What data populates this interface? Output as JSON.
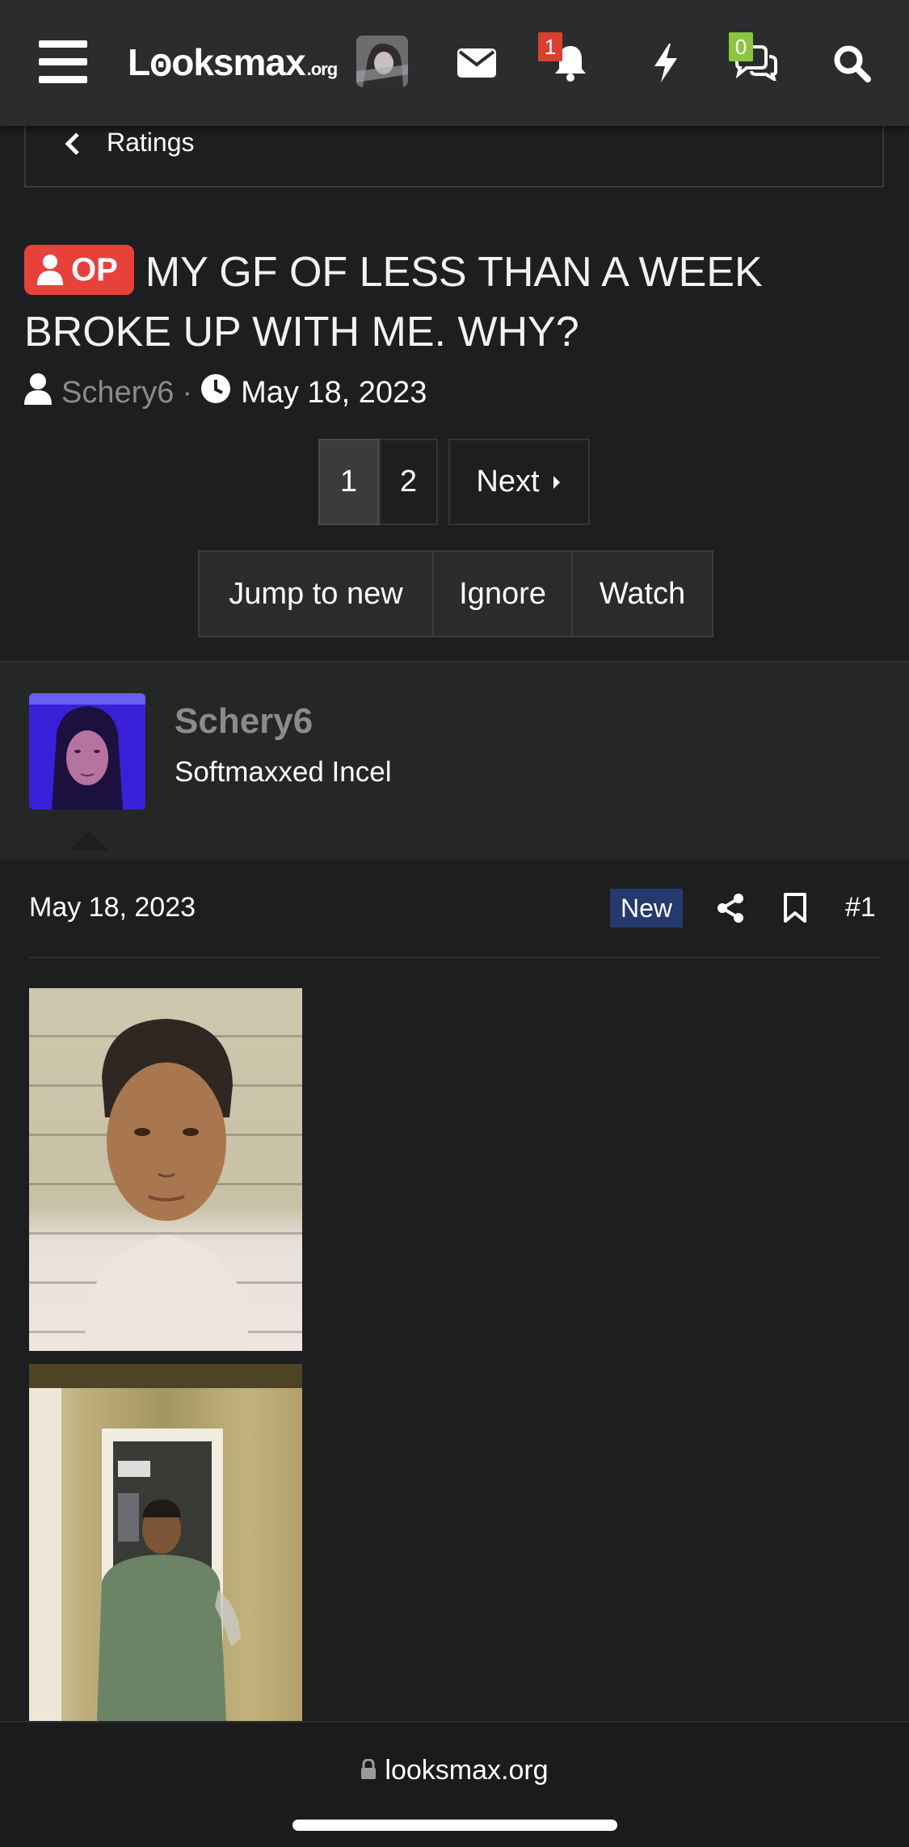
{
  "header": {
    "logo_text": "Lꙩoksmax",
    "logo_suffix": ".org",
    "notifications_count": "1",
    "conversations_count": "0",
    "icons": [
      "menu-icon",
      "avatar",
      "envelope-icon",
      "bell-icon",
      "bolt-icon",
      "chat-icon",
      "search-icon"
    ]
  },
  "breadcrumb": {
    "label": "Ratings"
  },
  "thread": {
    "op_label": "OP",
    "title": "MY GF OF LESS THAN A WEEK BROKE UP WITH ME. WHY?",
    "author": "Schery6",
    "separator": "·",
    "date": "May 18, 2023"
  },
  "pagination": {
    "pages": [
      "1",
      "2"
    ],
    "current": "1",
    "next_label": "Next"
  },
  "actions": {
    "jump_label": "Jump to new",
    "ignore_label": "Ignore",
    "watch_label": "Watch"
  },
  "post": {
    "username": "Schery6",
    "user_title": "Softmaxxed Incel",
    "date": "May 18, 2023",
    "new_label": "New",
    "number": "#1"
  },
  "footer": {
    "url": "looksmax.org"
  },
  "colors": {
    "background": "#1d1e20",
    "topbar": "#2b2c2e",
    "op_badge": "#e8413c",
    "notif_badge": "#d9412f",
    "chat_badge": "#8cc63e",
    "new_badge": "#26396f",
    "muted_text": "#8a8b8d"
  }
}
